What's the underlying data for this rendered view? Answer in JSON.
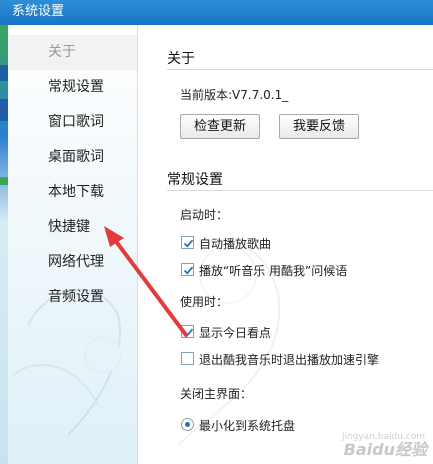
{
  "window": {
    "title": "系统设置"
  },
  "sidebar": {
    "items": [
      {
        "label": "关于"
      },
      {
        "label": "常规设置"
      },
      {
        "label": "窗口歌词"
      },
      {
        "label": "桌面歌词"
      },
      {
        "label": "本地下载"
      },
      {
        "label": "快捷键"
      },
      {
        "label": "网络代理"
      },
      {
        "label": "音频设置"
      }
    ],
    "active_index": 0
  },
  "about": {
    "title": "关于",
    "version_text": "当前版本:V7.7.0.1_",
    "check_update_label": "检查更新",
    "feedback_label": "我要反馈"
  },
  "general": {
    "title": "常规设置",
    "on_start_label": "启动时：",
    "auto_play_label": "自动播放歌曲",
    "auto_play_checked": true,
    "greeting_label": "播放“听音乐 用酷我”问候语",
    "greeting_checked": true,
    "in_use_label": "使用时：",
    "show_today_label": "显示今日看点",
    "show_today_checked": true,
    "exit_accel_label": "退出酷我音乐时退出播放加速引擎",
    "exit_accel_checked": false,
    "close_main_label": "关闭主界面：",
    "minimize_tray_label": "最小化到系统托盘",
    "minimize_tray_selected": true
  },
  "colors": {
    "title_bar": "#1a76c4",
    "arrow": "#e23b3b",
    "check": "#2a6ebd"
  },
  "watermark": {
    "text": "Baidu经验",
    "sub": "jingyan.baidu.com"
  }
}
